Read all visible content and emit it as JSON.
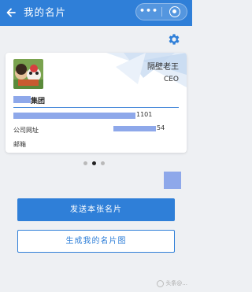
{
  "header": {
    "title": "我的名片",
    "back_icon": "arrow-left-icon",
    "more_icon": "more-dots-icon",
    "close_icon": "target-circle-icon",
    "background_color": "#2f7fd8"
  },
  "card": {
    "name": "隔壁老王",
    "role": "CEO",
    "company_suffix": "集团",
    "phone_suffix": "1101",
    "website_label": "公司网址",
    "website_suffix": "54",
    "email_label": "邮箱"
  },
  "pager": {
    "total": 3,
    "active": 2
  },
  "actions": {
    "send_label": "发送本张名片",
    "generate_label": "生成我的名片图"
  },
  "watermark": "头条@...",
  "colors": {
    "primary": "#2f7fd8",
    "redaction": "#8ea8ea",
    "page_bg": "#eef0f3"
  }
}
